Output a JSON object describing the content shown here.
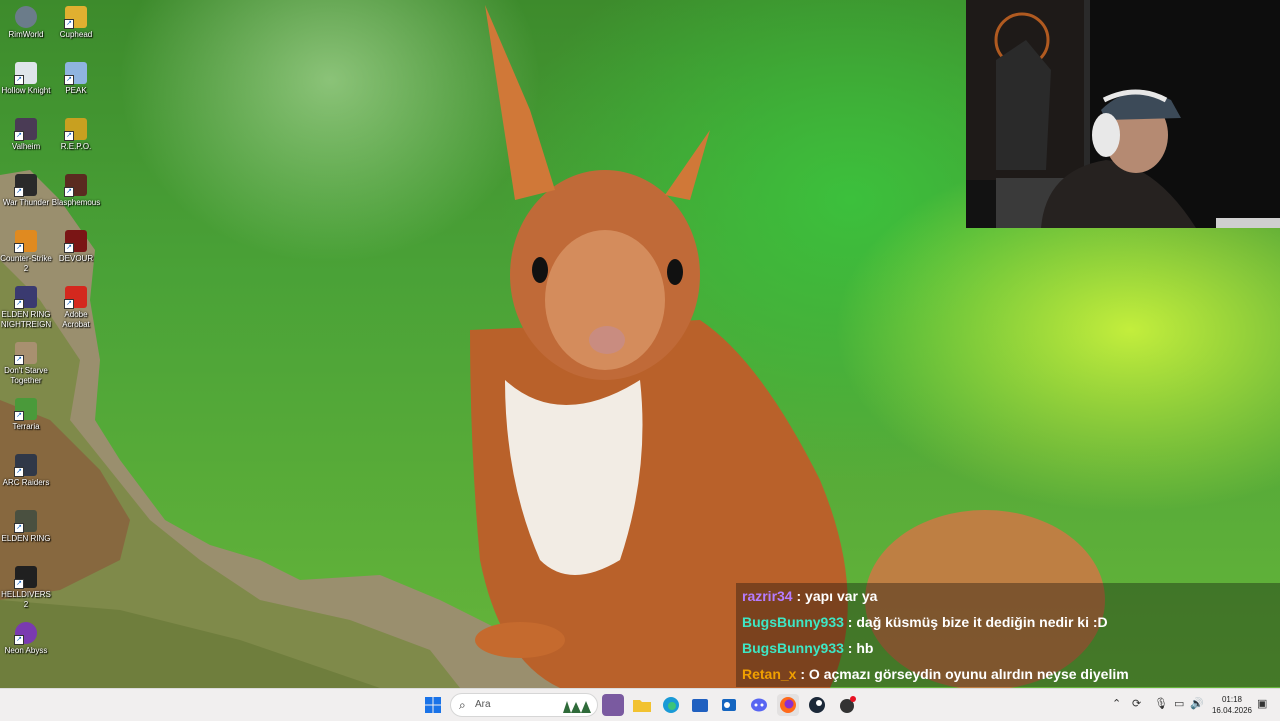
{
  "desktop": {
    "icons": [
      {
        "label": "RimWorld",
        "icon": "rimworld-icon",
        "color": "#6b7c8a"
      },
      {
        "label": "Cuphead",
        "icon": "cuphead-icon",
        "color": "#e0b030"
      },
      {
        "label": "Hollow Knight",
        "icon": "hollow-knight-icon",
        "color": "#dfe5ea"
      },
      {
        "label": "PEAK",
        "icon": "peak-icon",
        "color": "#8fb4e0"
      },
      {
        "label": "Valheim",
        "icon": "valheim-icon",
        "color": "#4a3b55"
      },
      {
        "label": "R.E.P.O.",
        "icon": "repo-icon",
        "color": "#c8a020"
      },
      {
        "label": "War Thunder",
        "icon": "war-thunder-icon",
        "color": "#2a2a2a"
      },
      {
        "label": "Blasphemous",
        "icon": "blasphemous-icon",
        "color": "#5a2b20"
      },
      {
        "label": "Counter-Strike 2",
        "icon": "counter-strike-icon",
        "color": "#e08a20"
      },
      {
        "label": "DEVOUR",
        "icon": "devour-icon",
        "color": "#7a1515"
      },
      {
        "label": "ELDEN RING NIGHTREIGN",
        "icon": "elden-ring-nightreign-icon",
        "color": "#3a3a70"
      },
      {
        "label": "Adobe Acrobat",
        "icon": "adobe-acrobat-icon",
        "color": "#d4281e"
      },
      {
        "label": "Don't Starve Together",
        "icon": "dont-starve-icon",
        "color": "#a89070"
      },
      {
        "label": "Terraria",
        "icon": "terraria-icon",
        "color": "#4a9a3a"
      },
      {
        "label": "ARC Raiders",
        "icon": "arc-raiders-icon",
        "color": "#303848"
      },
      {
        "label": "ELDEN RING",
        "icon": "elden-ring-icon",
        "color": "#4a5040"
      },
      {
        "label": "HELLDIVERS 2",
        "icon": "helldivers-icon",
        "color": "#202020"
      },
      {
        "label": "Neon Abyss",
        "icon": "neon-abyss-icon",
        "color": "#7a3ab0"
      }
    ]
  },
  "chat": {
    "messages": [
      {
        "user": "razrir34",
        "color": "#b57cff",
        "text": " : yapı var ya"
      },
      {
        "user": "BugsBunny933",
        "color": "#3ee6c4",
        "text": " : dağ küsmüş bize it dediğin nedir ki :D"
      },
      {
        "user": "BugsBunny933",
        "color": "#3ee6c4",
        "text": " : hb"
      },
      {
        "user": "Retan_x",
        "color": "#f0a000",
        "text": " : O açmazı görseydin oyunu alırdın neyse diyelim"
      }
    ]
  },
  "taskbar": {
    "search_placeholder": "Ara",
    "apps": [
      {
        "icon": "start-icon",
        "color": "#1a73e8"
      },
      {
        "icon": "widgets-icon",
        "color": "#3a8a3a"
      },
      {
        "icon": "store-icon",
        "color": "#7a5aa0"
      },
      {
        "icon": "file-explorer-icon",
        "color": "#f2c230"
      },
      {
        "icon": "edge-icon",
        "color": "#1a9ad6"
      },
      {
        "icon": "microsoft-store-icon",
        "color": "#2060c0"
      },
      {
        "icon": "outlook-icon",
        "color": "#1565c0"
      },
      {
        "icon": "discord-icon",
        "color": "#5865f2"
      },
      {
        "icon": "firefox-icon",
        "color": "#ff6a1a"
      },
      {
        "icon": "steam-icon",
        "color": "#1b2838"
      },
      {
        "icon": "game-launcher-icon",
        "color": "#333333"
      }
    ],
    "time": "01:18",
    "date": "16.04.2026"
  }
}
